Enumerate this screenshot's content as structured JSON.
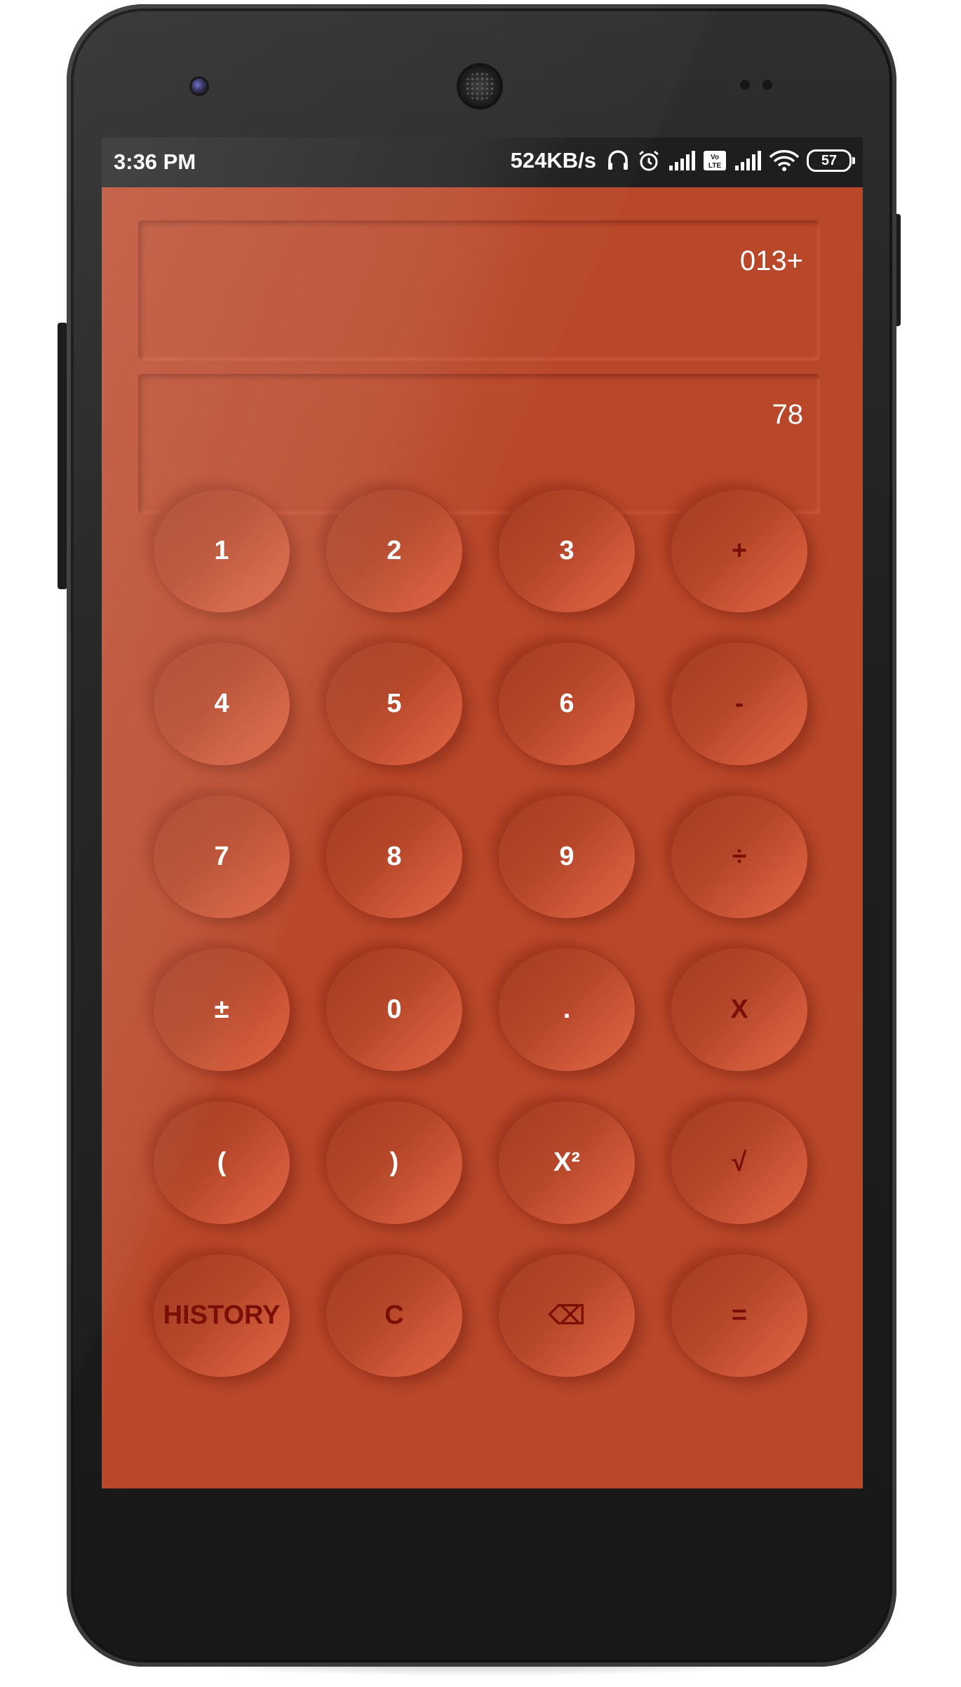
{
  "status_bar": {
    "time": "3:36 PM",
    "net_speed": "524KB/s",
    "battery": "57",
    "icons": [
      "headphones-icon",
      "alarm-icon",
      "signal-icon",
      "volte-icon",
      "signal-icon",
      "wifi-icon",
      "battery-icon"
    ]
  },
  "display": {
    "expression": "013+",
    "result": "78"
  },
  "keys": [
    {
      "label": "1",
      "kind": "digit"
    },
    {
      "label": "2",
      "kind": "digit"
    },
    {
      "label": "3",
      "kind": "digit"
    },
    {
      "label": "+",
      "kind": "op"
    },
    {
      "label": "4",
      "kind": "digit"
    },
    {
      "label": "5",
      "kind": "digit"
    },
    {
      "label": "6",
      "kind": "digit"
    },
    {
      "label": "-",
      "kind": "op"
    },
    {
      "label": "7",
      "kind": "digit"
    },
    {
      "label": "8",
      "kind": "digit"
    },
    {
      "label": "9",
      "kind": "digit"
    },
    {
      "label": "÷",
      "kind": "op"
    },
    {
      "label": "±",
      "kind": "digit"
    },
    {
      "label": "0",
      "kind": "digit"
    },
    {
      "label": ".",
      "kind": "digit"
    },
    {
      "label": "X",
      "kind": "op"
    },
    {
      "label": "(",
      "kind": "digit"
    },
    {
      "label": ")",
      "kind": "digit"
    },
    {
      "label": "X²",
      "kind": "digit"
    },
    {
      "label": "√",
      "kind": "op"
    },
    {
      "label": "HISTORY",
      "kind": "op"
    },
    {
      "label": "C",
      "kind": "op"
    },
    {
      "label": "⌫",
      "kind": "op"
    },
    {
      "label": "=",
      "kind": "op"
    }
  ],
  "colors": {
    "screen_bg": "#b9472a",
    "key_text": "#ffffff",
    "op_text": "#7a0f08",
    "status_bar_bg": "#1e1e1e"
  }
}
